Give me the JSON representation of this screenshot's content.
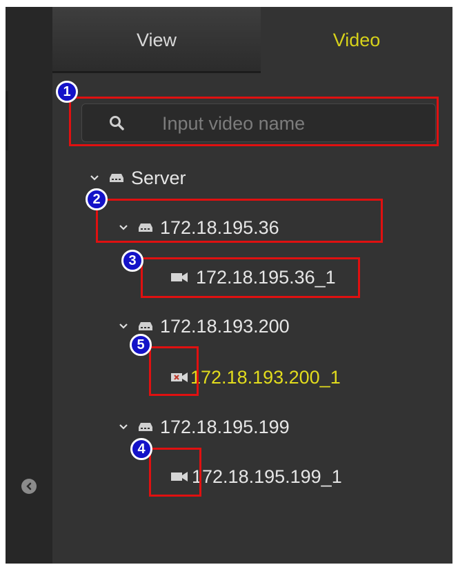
{
  "tabs": [
    {
      "label": "View",
      "active": false
    },
    {
      "label": "Video",
      "active": true
    }
  ],
  "search": {
    "placeholder": "Input video name",
    "value": ""
  },
  "tree": {
    "root": {
      "label": "Server",
      "expanded": true
    },
    "servers": [
      {
        "label": "172.18.195.36",
        "expanded": true,
        "camera": {
          "label": "172.18.195.36_1",
          "status": "online"
        }
      },
      {
        "label": "172.18.193.200",
        "expanded": true,
        "camera": {
          "label": "172.18.193.200_1",
          "status": "offline"
        }
      },
      {
        "label": "172.18.195.199",
        "expanded": true,
        "camera": {
          "label": "172.18.195.199_1",
          "status": "online"
        }
      }
    ]
  },
  "annotations": [
    "1",
    "2",
    "3",
    "5",
    "4"
  ],
  "colors": {
    "accent": "#d7d21a",
    "panel": "#333333",
    "annotation_box": "#e01010",
    "annotation_badge": "#1412c8",
    "offline_mark": "#c0392b"
  }
}
